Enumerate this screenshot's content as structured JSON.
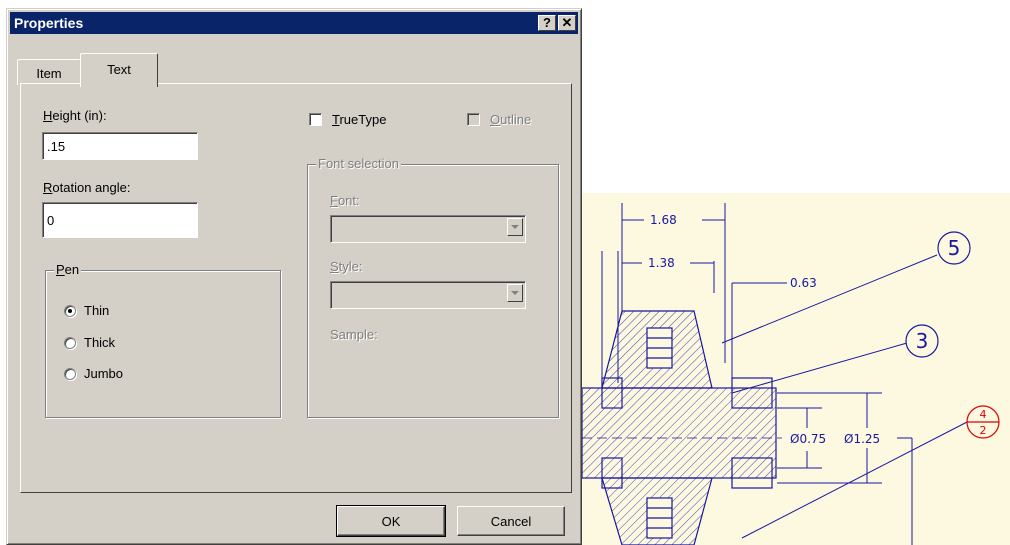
{
  "window": {
    "title": "Properties",
    "help_label": "?",
    "close_label": "✕"
  },
  "tabs": [
    {
      "label": "Item",
      "active": false
    },
    {
      "label": "Text",
      "active": true
    }
  ],
  "height": {
    "label_underline": "H",
    "label_rest": "eight (in):",
    "value": ".15"
  },
  "rotation": {
    "label_underline": "R",
    "label_rest": "otation angle:",
    "value": "0"
  },
  "pen": {
    "title_underline": "P",
    "title_rest": "en",
    "options": [
      {
        "label": "Thin",
        "checked": true
      },
      {
        "label": "Thick",
        "checked": false
      },
      {
        "label": "Jumbo",
        "checked": false
      }
    ]
  },
  "truetype": {
    "label_underline": "T",
    "label_rest": "rueType",
    "checked": false
  },
  "outline": {
    "label_underline": "O",
    "label_rest": "utline",
    "checked": false,
    "enabled": false
  },
  "font_selection": {
    "title": "Font selection",
    "font_label_underline": "F",
    "font_label_rest": "ont:",
    "style_label_underline": "S",
    "style_label_rest": "tyle:",
    "sample_label": "Sample:"
  },
  "buttons": {
    "ok": "OK",
    "cancel": "Cancel"
  },
  "drawing": {
    "dims": [
      "1.68",
      "1.38",
      "0.63",
      "Ø0.75",
      "Ø1.25"
    ],
    "balloons": [
      "5",
      "3"
    ],
    "callout": {
      "top": "4",
      "bottom": "2"
    }
  },
  "colors": {
    "titlebar": "#0a246a",
    "dialog_face": "#d4d0c8",
    "drawing_bg": "#fdf8e0",
    "line_blue": "#1818a0",
    "callout_red": "#e00000"
  }
}
